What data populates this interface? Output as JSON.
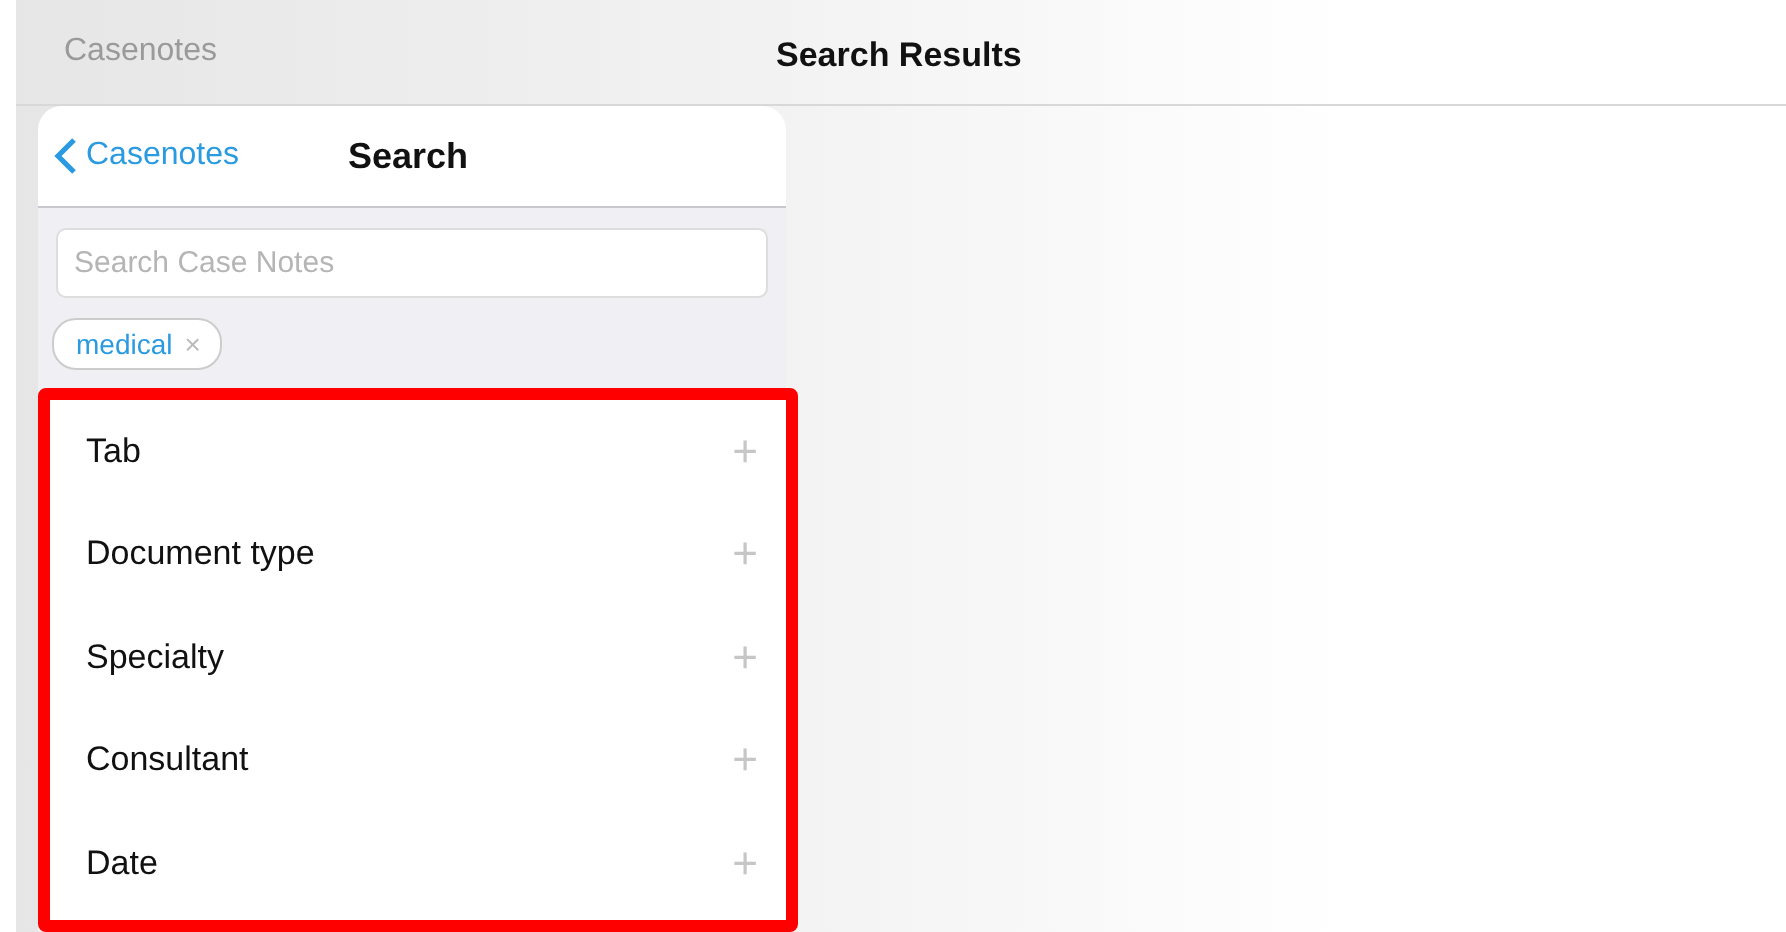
{
  "top_bar": {
    "back_label": "Casenotes",
    "title": "Search Results"
  },
  "popover": {
    "back_label": "Casenotes",
    "title": "Search",
    "search": {
      "placeholder": "Search Case Notes"
    },
    "tags": [
      {
        "label": "medical",
        "remove": "×"
      }
    ],
    "filters": [
      {
        "label": "Tab",
        "add": "+"
      },
      {
        "label": "Document type",
        "add": "+"
      },
      {
        "label": "Specialty",
        "add": "+"
      },
      {
        "label": "Consultant",
        "add": "+"
      },
      {
        "label": "Date",
        "add": "+"
      }
    ]
  }
}
